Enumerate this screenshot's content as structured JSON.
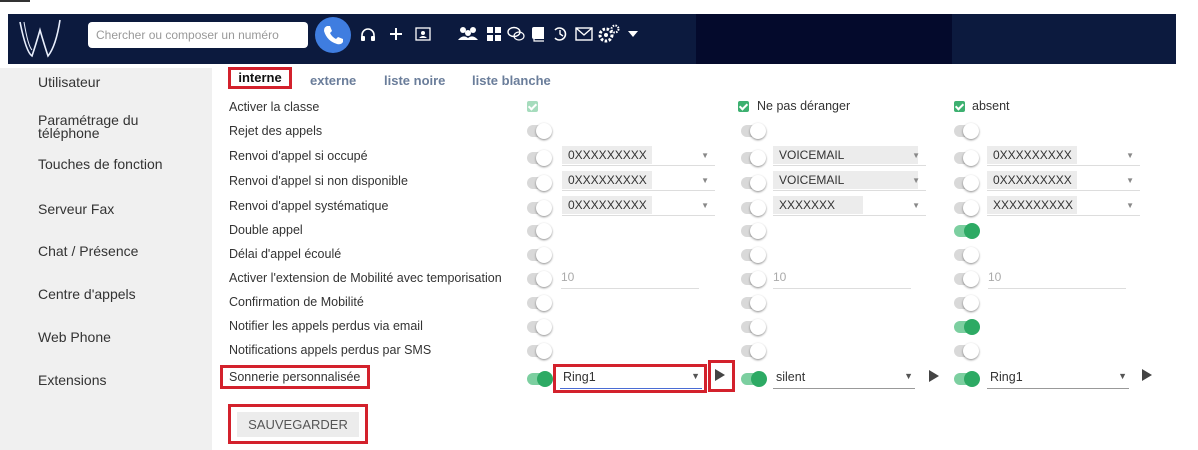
{
  "header": {
    "search_placeholder": "Chercher ou composer un numéro",
    "icons": [
      "phone-icon",
      "headset-icon",
      "plus-icon",
      "contact-card-icon",
      "users-icon",
      "grid-icon",
      "chat-icon",
      "book-icon",
      "history-icon",
      "mail-icon",
      "settings-icon",
      "chevron-down-icon"
    ]
  },
  "sidebar": {
    "items": [
      {
        "label": "Utilisateur"
      },
      {
        "label": "Paramétrage du téléphone"
      },
      {
        "label": "Touches de fonction"
      },
      {
        "label": "Serveur Fax"
      },
      {
        "label": "Chat / Présence"
      },
      {
        "label": "Centre d'appels"
      },
      {
        "label": "Web Phone"
      },
      {
        "label": "Extensions"
      }
    ]
  },
  "tabs": [
    {
      "label": "interne",
      "active": true
    },
    {
      "label": "externe"
    },
    {
      "label": "liste noire"
    },
    {
      "label": "liste blanche"
    }
  ],
  "columns": [
    {
      "header": ""
    },
    {
      "header": "Ne pas déranger"
    },
    {
      "header": "absent"
    }
  ],
  "rows": [
    {
      "label": "Activer la classe"
    },
    {
      "label": "Rejet des appels"
    },
    {
      "label": "Renvoi d'appel si occupé",
      "values": [
        "0XXXXXXXXX",
        "VOICEMAIL",
        "0XXXXXXXXX"
      ]
    },
    {
      "label": "Renvoi d'appel si non disponible",
      "values": [
        "0XXXXXXXXX",
        "VOICEMAIL",
        "0XXXXXXXXX"
      ]
    },
    {
      "label": "Renvoi d'appel systématique",
      "values": [
        "0XXXXXXXXX",
        "XXXXXXX",
        "XXXXXXXXXX"
      ]
    },
    {
      "label": "Double appel"
    },
    {
      "label": "Délai d'appel écoulé"
    },
    {
      "label": "Activer l'extension de Mobilité avec temporisation",
      "values": [
        "10",
        "10",
        "10"
      ]
    },
    {
      "label": "Confirmation de Mobilité"
    },
    {
      "label": "Notifier les appels perdus via email"
    },
    {
      "label": "Notifications appels perdus par SMS"
    },
    {
      "label": "Sonnerie personnalisée",
      "values": [
        "Ring1",
        "silent",
        "Ring1"
      ]
    }
  ],
  "save_label": "SAUVEGARDER"
}
